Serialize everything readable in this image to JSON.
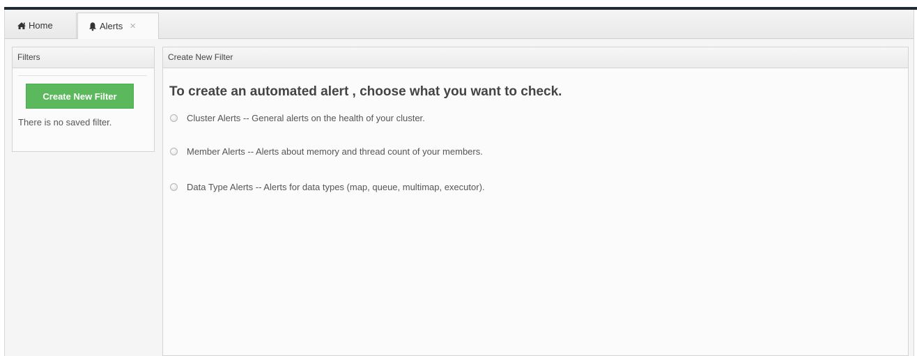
{
  "tabs": [
    {
      "label": "Home",
      "icon": "home-icon"
    },
    {
      "label": "Alerts",
      "icon": "bell-icon",
      "close": "×"
    }
  ],
  "filters_panel": {
    "title": "Filters",
    "create_button": "Create New Filter",
    "empty_message": "There is no saved filter."
  },
  "main_panel": {
    "title": "Create New Filter",
    "heading": "To create an automated alert , choose what you want to check.",
    "options": [
      {
        "label": "Cluster Alerts -- General alerts on the health of your cluster."
      },
      {
        "label": "Member Alerts -- Alerts about memory and thread count of your members."
      },
      {
        "label": "Data Type Alerts -- Alerts for data types (map, queue, multimap, executor)."
      }
    ]
  },
  "colors": {
    "accent_green": "#5cb85c",
    "top_bar": "#1f2a33"
  }
}
